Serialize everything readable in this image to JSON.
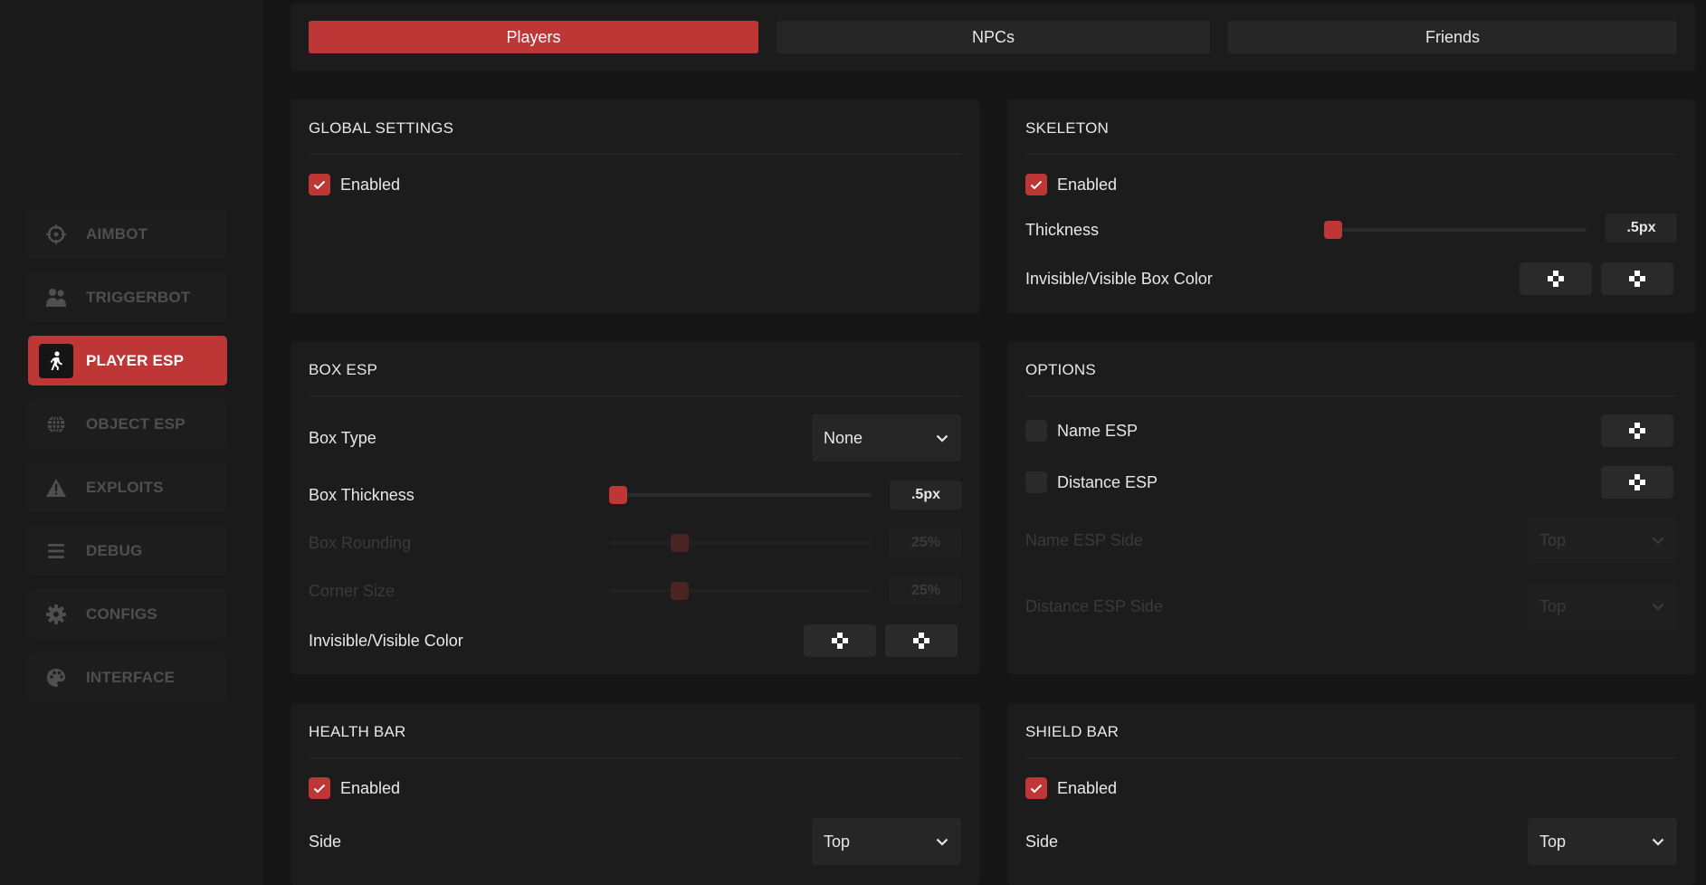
{
  "tabs": [
    {
      "label": "Players",
      "active": true
    },
    {
      "label": "NPCs",
      "active": false
    },
    {
      "label": "Friends",
      "active": false
    }
  ],
  "sidebar": {
    "items": [
      {
        "label": "AIMBOT",
        "icon": "crosshair-icon",
        "active": false
      },
      {
        "label": "TRIGGERBOT",
        "icon": "users-icon",
        "active": false
      },
      {
        "label": "PLAYER ESP",
        "icon": "walking-person-icon",
        "active": true
      },
      {
        "label": "OBJECT ESP",
        "icon": "globe-icon",
        "active": false
      },
      {
        "label": "EXPLOITS",
        "icon": "warning-icon",
        "active": false
      },
      {
        "label": "DEBUG",
        "icon": "menu-lines-icon",
        "active": false
      },
      {
        "label": "CONFIGS",
        "icon": "gear-icon",
        "active": false
      },
      {
        "label": "INTERFACE",
        "icon": "palette-icon",
        "active": false
      }
    ]
  },
  "global_settings": {
    "title": "GLOBAL SETTINGS",
    "enabled_label": "Enabled",
    "enabled": true
  },
  "skeleton": {
    "title": "SKELETON",
    "enabled_label": "Enabled",
    "enabled": true,
    "thickness_label": "Thickness",
    "thickness_value": ".5px",
    "thickness_fraction": 0.0,
    "color_label": "Invisible/Visible Box Color"
  },
  "box_esp": {
    "title": "BOX ESP",
    "box_type_label": "Box Type",
    "box_type_value": "None",
    "box_thickness_label": "Box Thickness",
    "box_thickness_value": ".5px",
    "box_thickness_fraction": 0.0,
    "box_rounding_label": "Box Rounding",
    "box_rounding_value": "25%",
    "box_rounding_fraction": 0.25,
    "corner_size_label": "Corner Size",
    "corner_size_value": "25%",
    "corner_size_fraction": 0.25,
    "color_label": "Invisible/Visible Color"
  },
  "options": {
    "title": "OPTIONS",
    "name_esp_label": "Name ESP",
    "name_esp": false,
    "distance_esp_label": "Distance ESP",
    "distance_esp": false,
    "name_esp_side_label": "Name ESP Side",
    "name_esp_side_value": "Top",
    "distance_esp_side_label": "Distance ESP Side",
    "distance_esp_side_value": "Top"
  },
  "health_bar": {
    "title": "HEALTH BAR",
    "enabled_label": "Enabled",
    "enabled": true,
    "side_label": "Side",
    "side_value": "Top"
  },
  "shield_bar": {
    "title": "SHIELD BAR",
    "enabled_label": "Enabled",
    "enabled": true,
    "side_label": "Side",
    "side_value": "Top"
  },
  "colors": {
    "accent": "#bf3636",
    "background": "#151515",
    "panel": "#1c1c1c"
  }
}
